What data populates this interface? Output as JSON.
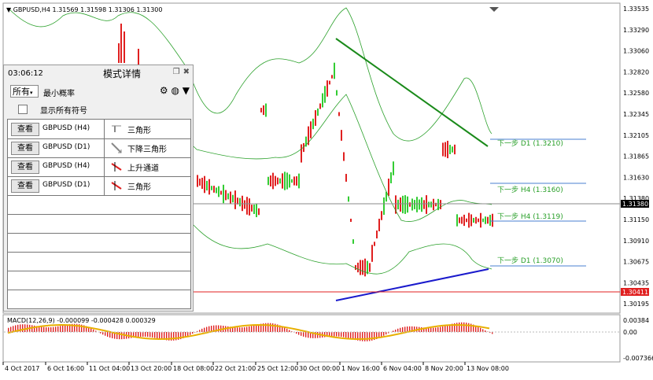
{
  "chart_title": "GBPUSD,H4  1.31569 1.31598 1.31306 1.31300",
  "current_price": "1.31380",
  "red_line_price": "1.30411",
  "price_ticks": [
    "1.33535",
    "1.33290",
    "1.33060",
    "1.32820",
    "1.32580",
    "1.32345",
    "1.32105",
    "1.31865",
    "1.31630",
    "1.31380",
    "1.31150",
    "1.30910",
    "1.30675",
    "1.30435",
    "1.30195"
  ],
  "time_ticks": [
    "4 Oct 2017",
    "6 Oct 16:00",
    "11 Oct 04:00",
    "13 Oct 20:00",
    "18 Oct 08:00",
    "22 Oct 21:00",
    "25 Oct 12:00",
    "30 Oct 00:00",
    "1 Nov 16:00",
    "6 Nov 04:00",
    "8 Nov 20:00",
    "13 Nov 08:00"
  ],
  "macd": {
    "label": "MACD(12,26,9) -0.000099 -0.000428 0.000329",
    "ticks": [
      "0.00384",
      "0.00",
      "-0.007366"
    ]
  },
  "targets": [
    {
      "label": "下一步 D1 (1.3210)",
      "color": "#2aa02a"
    },
    {
      "label": "下一步 H4 (1.3160)",
      "color": "#2aa02a"
    },
    {
      "label": "下一步 H4 (1.3119)",
      "color": "#2aa02a"
    },
    {
      "label": "下一步 D1 (1.3070)",
      "color": "#2aa02a"
    }
  ],
  "panel": {
    "time": "03:06:12",
    "title": "模式详情",
    "filter_value": "所有",
    "min_prob_label": "最小概率",
    "show_all_label": "显示所有符号",
    "rows": [
      {
        "button": "查看",
        "symbol": "GBPUSD (H4)",
        "pattern": "三角形",
        "icon": "triangle-icon"
      },
      {
        "button": "查看",
        "symbol": "GBPUSD (D1)",
        "pattern": "下降三角形",
        "icon": "descending-triangle-icon"
      },
      {
        "button": "查看",
        "symbol": "GBPUSD (H4)",
        "pattern": "上升通道",
        "icon": "ascending-channel-icon"
      },
      {
        "button": "查看",
        "symbol": "GBPUSD (D1)",
        "pattern": "三角形",
        "icon": "triangle-icon"
      }
    ]
  },
  "colors": {
    "bull": "#33cc33",
    "bear": "#e02020",
    "band": "#2aa02a",
    "resistance": "#1a8a1a",
    "support": "#1a1acc",
    "macd_signal": "#e8b000"
  }
}
